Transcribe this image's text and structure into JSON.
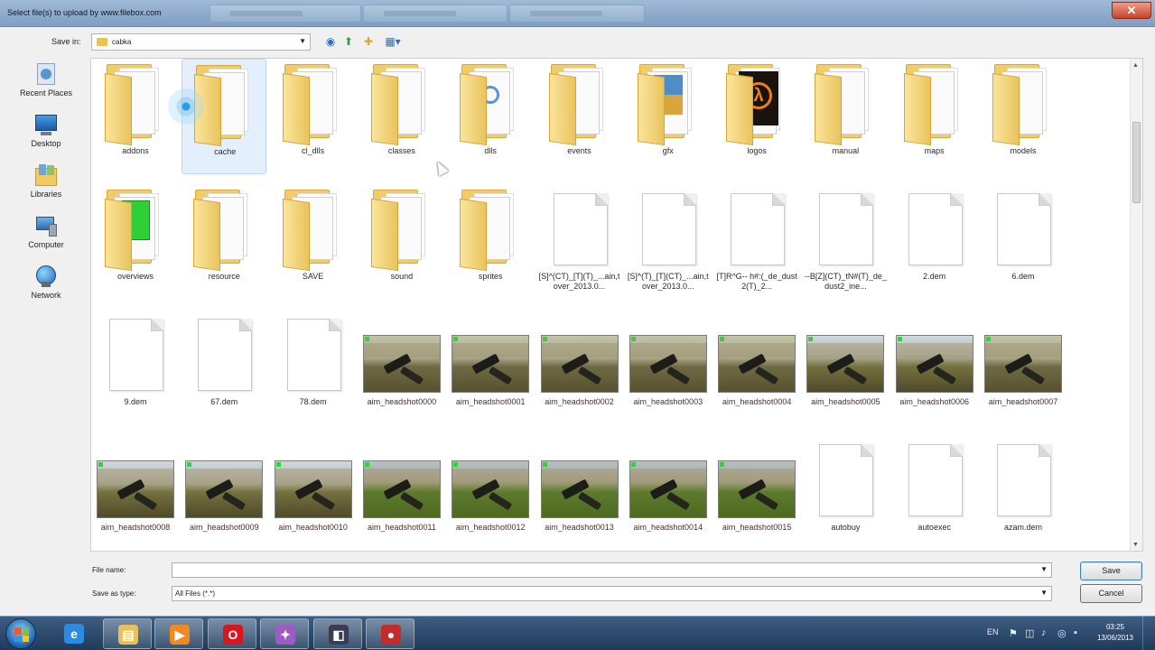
{
  "window": {
    "title": "Select file(s) to upload by www.filebox.com",
    "close_glyph": "✕"
  },
  "toolbar": {
    "save_in_label": "Save in:",
    "save_in_value": "cabka"
  },
  "places": [
    {
      "label": "Recent Places",
      "icon": "recent-places-icon"
    },
    {
      "label": "Desktop",
      "icon": "desktop-icon"
    },
    {
      "label": "Libraries",
      "icon": "libraries-icon"
    },
    {
      "label": "Computer",
      "icon": "computer-icon"
    },
    {
      "label": "Network",
      "icon": "network-icon"
    }
  ],
  "items": [
    {
      "label": "addons",
      "kind": "folder"
    },
    {
      "label": "cache",
      "kind": "folder",
      "selected": true
    },
    {
      "label": "cl_dlls",
      "kind": "folder"
    },
    {
      "label": "classes",
      "kind": "folder"
    },
    {
      "label": "dlls",
      "kind": "folder"
    },
    {
      "label": "events",
      "kind": "folder"
    },
    {
      "label": "gfx",
      "kind": "folder"
    },
    {
      "label": "logos",
      "kind": "folder"
    },
    {
      "label": "manual",
      "kind": "folder"
    },
    {
      "label": "maps",
      "kind": "folder"
    },
    {
      "label": "models",
      "kind": "folder"
    },
    {
      "label": "overviews",
      "kind": "folder"
    },
    {
      "label": "resource",
      "kind": "folder"
    },
    {
      "label": "SAVE",
      "kind": "folder"
    },
    {
      "label": "sound",
      "kind": "folder"
    },
    {
      "label": "sprites",
      "kind": "folder"
    },
    {
      "label": "[S]^(CT)_[T](T)_...ain,t over_2013.0...",
      "kind": "file"
    },
    {
      "label": "[S]^(T)_[T](CT)_...ain,t over_2013.0...",
      "kind": "file"
    },
    {
      "label": "[T]R^G-- h#:(_de_dust2(T)_2...",
      "kind": "file"
    },
    {
      "label": "--B[Z](CT)_tN#(T)_de_dust2_ine...",
      "kind": "file"
    },
    {
      "label": "2.dem",
      "kind": "file"
    },
    {
      "label": "6.dem",
      "kind": "file"
    },
    {
      "label": "9.dem",
      "kind": "file"
    },
    {
      "label": "67.dem",
      "kind": "file"
    },
    {
      "label": "78.dem",
      "kind": "file"
    },
    {
      "label": "aim_headshot0000",
      "kind": "video",
      "scene": "a"
    },
    {
      "label": "aim_headshot0001",
      "kind": "video",
      "scene": "a"
    },
    {
      "label": "aim_headshot0002",
      "kind": "video",
      "scene": "a"
    },
    {
      "label": "aim_headshot0003",
      "kind": "video",
      "scene": "a"
    },
    {
      "label": "aim_headshot0004",
      "kind": "video",
      "scene": "a"
    },
    {
      "label": "aim_headshot0005",
      "kind": "video",
      "scene": "sky"
    },
    {
      "label": "aim_headshot0006",
      "kind": "video",
      "scene": "sky"
    },
    {
      "label": "aim_headshot0007",
      "kind": "video",
      "scene": "a"
    },
    {
      "label": "aim_headshot0008",
      "kind": "video",
      "scene": "sky"
    },
    {
      "label": "aim_headshot0009",
      "kind": "video",
      "scene": "sky"
    },
    {
      "label": "aim_headshot0010",
      "kind": "video",
      "scene": "sky"
    },
    {
      "label": "aim_headshot0011",
      "kind": "video",
      "scene": "grass"
    },
    {
      "label": "aim_headshot0012",
      "kind": "video",
      "scene": "grass"
    },
    {
      "label": "aim_headshot0013",
      "kind": "video",
      "scene": "grass"
    },
    {
      "label": "aim_headshot0014",
      "kind": "video",
      "scene": "grass"
    },
    {
      "label": "aim_headshot0015",
      "kind": "video",
      "scene": "grass"
    },
    {
      "label": "autobuy",
      "kind": "file"
    },
    {
      "label": "autoexec",
      "kind": "file"
    },
    {
      "label": "azam.dem",
      "kind": "file"
    }
  ],
  "form": {
    "file_name_label": "File name:",
    "file_name_value": "",
    "save_as_type_label": "Save as type:",
    "save_as_type_value": "All Files (*.*)",
    "save_button": "Save",
    "cancel_button": "Cancel"
  },
  "taskbar": {
    "apps": [
      {
        "name": "internet-explorer",
        "glyph": "e",
        "color": "#2a8be0"
      },
      {
        "name": "windows-explorer",
        "glyph": "▤",
        "color": "#e6c35a"
      },
      {
        "name": "media-player",
        "glyph": "▶",
        "color": "#f08a1f"
      },
      {
        "name": "opera",
        "glyph": "O",
        "color": "#d8161d"
      },
      {
        "name": "app-purple",
        "glyph": "✦",
        "color": "#9d5cc4"
      },
      {
        "name": "app-dark",
        "glyph": "◧",
        "color": "#3b3b52"
      },
      {
        "name": "screen-recorder",
        "glyph": "●",
        "color": "#c42b2b"
      }
    ],
    "language": "EN",
    "time": "03:25",
    "date": "13/06/2013"
  },
  "colors": {
    "accent": "#3c7fb1",
    "selection": "#e3effc"
  }
}
